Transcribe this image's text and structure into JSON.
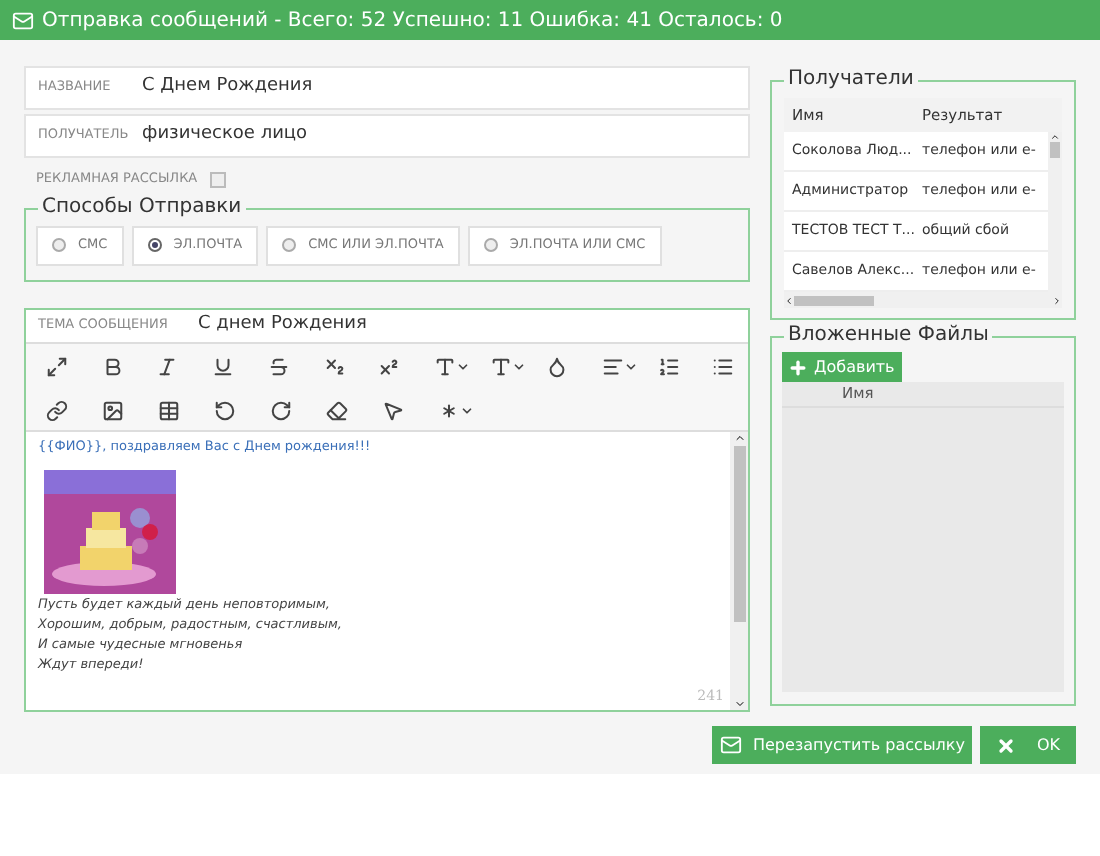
{
  "title": "Отправка сообщений - Всего: 52 Успешно: 11 Ошибка: 41 Осталось: 0",
  "fields": [
    {
      "label": "НАЗВАНИЕ",
      "value": "С Днем Рождения"
    },
    {
      "label": "ПОЛУЧАТЕЛЬ",
      "value": "физическое лицо"
    }
  ],
  "advert": {
    "label": "РЕКЛАМНАЯ РАССЫЛКА",
    "checked": false
  },
  "send_methods": {
    "legend": "Способы Отправки",
    "options": [
      {
        "label": "СМС",
        "selected": false
      },
      {
        "label": "ЭЛ.ПОЧТА",
        "selected": true
      },
      {
        "label": "СМС ИЛИ ЭЛ.ПОЧТА",
        "selected": false
      },
      {
        "label": "ЭЛ.ПОЧТА ИЛИ СМС",
        "selected": false
      }
    ]
  },
  "subject": {
    "label": "ТЕМА СООБЩЕНИЯ",
    "value": "С днем Рождения"
  },
  "editor": {
    "greeting": "{{ФИО}}, поздравляем Вас с Днем рождения!!!",
    "lines": [
      "Пусть будет каждый день неповторимым,",
      "Хорошим, добрым, радостным, счастливым,",
      "И самые чудесные мгновенья",
      "Ждут впереди!"
    ],
    "counter": "241"
  },
  "recipients": {
    "legend": "Получатели",
    "columns": [
      "Имя",
      "Результат"
    ],
    "rows": [
      [
        "Соколова Люд...",
        "телефон или е-"
      ],
      [
        "Администратор",
        "телефон или е-"
      ],
      [
        "ТЕСТОВ ТЕСТ Т...",
        "общий сбой"
      ],
      [
        "Савелов Алекс...",
        "телефон или е-"
      ]
    ]
  },
  "attachments": {
    "legend": "Вложенные Файлы",
    "add_button": "Добавить",
    "columns": [
      "Имя"
    ]
  },
  "buttons": [
    {
      "kind": "restart",
      "label": "Перезапустить рассылку"
    },
    {
      "kind": "ok",
      "label": "OK"
    }
  ]
}
